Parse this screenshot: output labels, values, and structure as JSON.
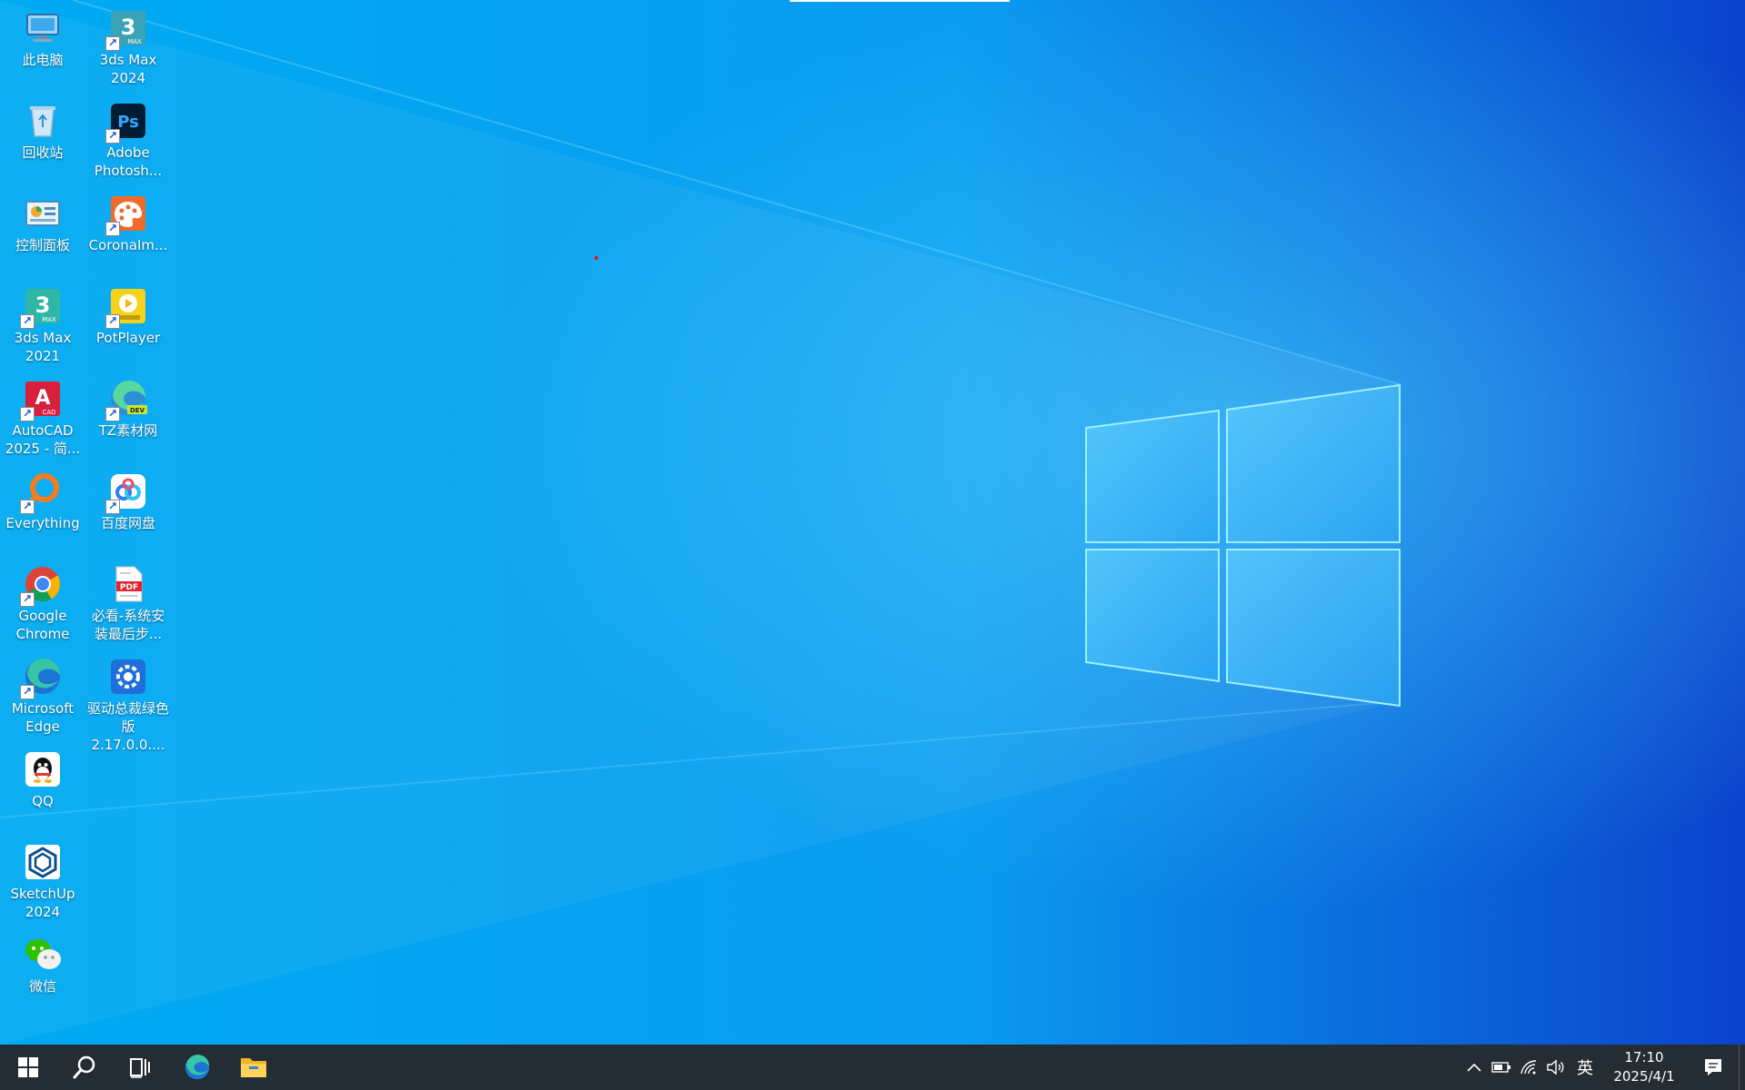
{
  "colors": {
    "wallpaper": "#0a7fe0",
    "taskbar": "#252d34",
    "label": "#ffffff"
  },
  "desktop_icons": [
    {
      "label": "此电脑",
      "icon": "computer-icon"
    },
    {
      "label": "回收站",
      "icon": "recycle-bin-icon"
    },
    {
      "label": "控制面板",
      "icon": "control-panel-icon"
    },
    {
      "label": "3ds Max\n2021",
      "icon": "3dsmax-icon"
    },
    {
      "label": "AutoCAD\n2025 - 简...",
      "icon": "autocad-icon"
    },
    {
      "label": "Everything",
      "icon": "everything-icon"
    },
    {
      "label": "Google\nChrome",
      "icon": "chrome-icon"
    },
    {
      "label": "Microsoft\nEdge",
      "icon": "edge-icon"
    },
    {
      "label": "QQ",
      "icon": "qq-icon"
    },
    {
      "label": "SketchUp\n2024",
      "icon": "sketchup-icon"
    },
    {
      "label": "微信",
      "icon": "wechat-icon"
    },
    {
      "label": "3ds Max\n2024",
      "icon": "3dsmax-icon"
    },
    {
      "label": "Adobe\nPhotosh...",
      "icon": "photoshop-icon"
    },
    {
      "label": "CoronaIm...",
      "icon": "corona-icon"
    },
    {
      "label": "PotPlayer",
      "icon": "potplayer-icon"
    },
    {
      "label": "TZ素材网",
      "icon": "edge-dev-icon"
    },
    {
      "label": "百度网盘",
      "icon": "baidu-netdisk-icon"
    },
    {
      "label": "必看-系统安\n装最后步...",
      "icon": "pdf-icon"
    },
    {
      "label": "驱动总裁绿色\n版2.17.0.0....",
      "icon": "driver-icon"
    }
  ],
  "taskbar": {
    "buttons": [
      "start-icon",
      "search-icon",
      "task-view-icon",
      "edge-icon",
      "file-explorer-icon"
    ],
    "tray": {
      "icons": [
        "chevron-up-icon",
        "battery-icon",
        "network-icon",
        "volume-icon"
      ],
      "ime": "英",
      "time": "17:10",
      "date": "2025/4/1"
    }
  }
}
